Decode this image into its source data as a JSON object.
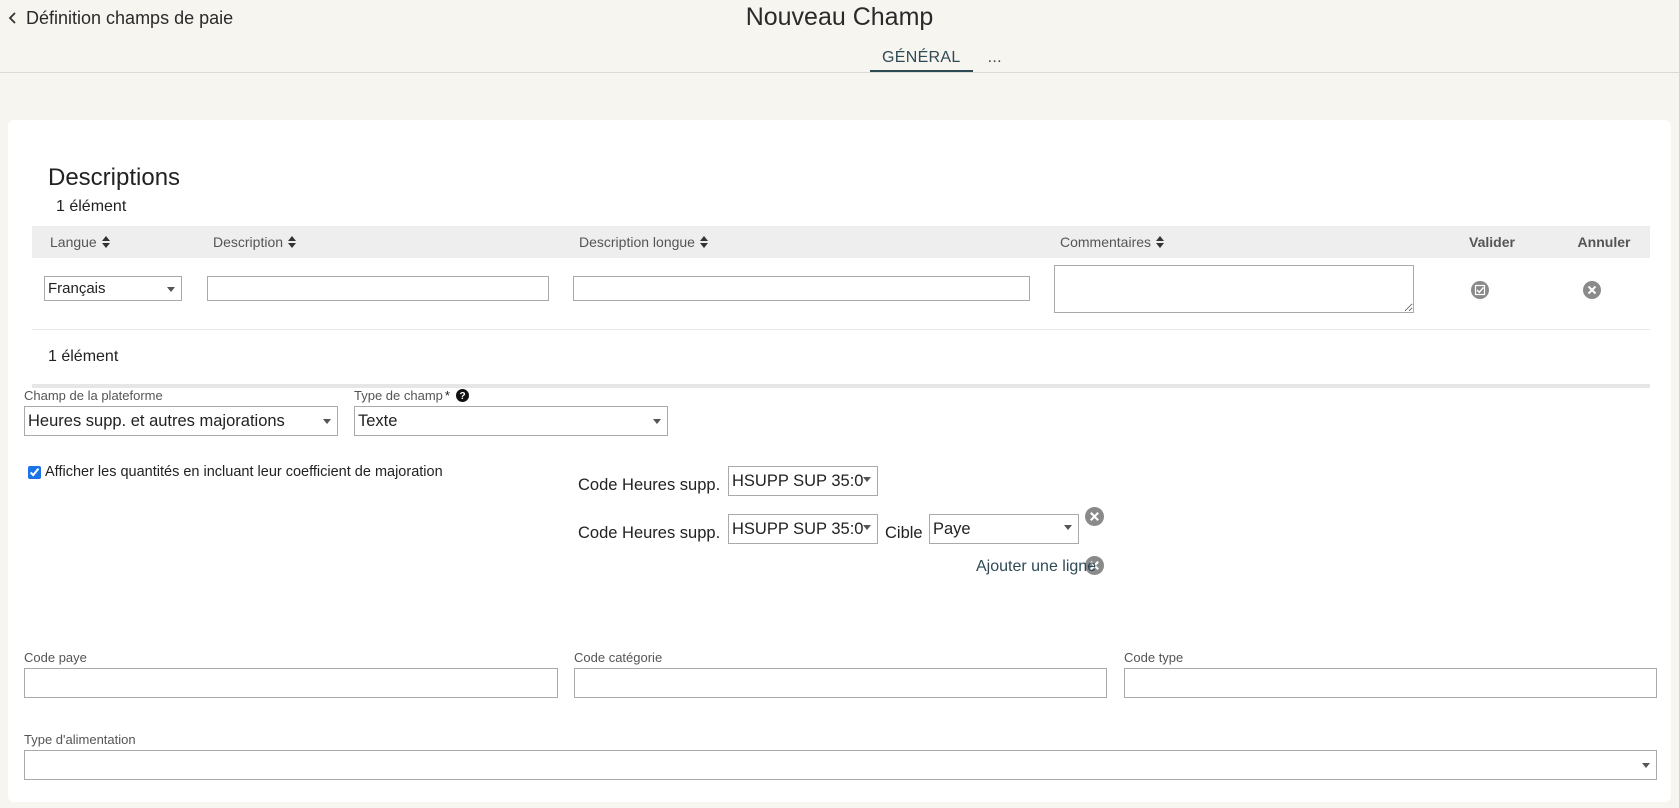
{
  "header": {
    "back_label": "Définition champs de paie",
    "title": "Nouveau Champ",
    "tabs": [
      {
        "label": "GÉNÉRAL",
        "active": true
      },
      {
        "label": "..."
      }
    ]
  },
  "descriptions": {
    "title": "Descriptions",
    "count_top": "1 élément",
    "count_bottom": "1 élément",
    "columns": {
      "langue": "Langue",
      "description": "Description",
      "description_longue": "Description longue",
      "commentaires": "Commentaires",
      "valider": "Valider",
      "annuler": "Annuler"
    },
    "row": {
      "langue": "Français",
      "description": "",
      "description_longue": "",
      "commentaires": ""
    }
  },
  "form": {
    "champ_plateforme_label": "Champ de la plateforme",
    "champ_plateforme_value": "Heures supp. et autres majorations",
    "type_champ_label": "Type de champ",
    "type_champ_required": "*",
    "type_champ_value": "Texte",
    "checkbox_label": "Afficher les quantités en incluant leur coefficient de majoration",
    "checkbox_checked": true,
    "code_lines": [
      {
        "label": "Code Heures supp.",
        "value": "HSUPP SUP 35:0"
      },
      {
        "label": "Code Heures supp.",
        "value": "HSUPP SUP 35:0",
        "cible_label": "Cible",
        "cible_value": "Paye"
      }
    ],
    "add_line_label": "Ajouter une ligne",
    "code_paye_label": "Code paye",
    "code_paye_value": "",
    "code_categorie_label": "Code catégorie",
    "code_categorie_value": "",
    "code_type_label": "Code type",
    "code_type_value": "",
    "type_alimentation_label": "Type d'alimentation",
    "type_alimentation_value": ""
  },
  "colors": {
    "background": "#f7f5f0",
    "accent": "#2e4a55",
    "table_header": "#eeeeee",
    "icon_gray": "#8a8a8a"
  }
}
